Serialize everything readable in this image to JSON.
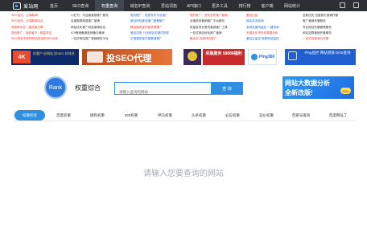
{
  "nav": {
    "logo": "爱站网",
    "items": [
      "首页",
      "SEO查询",
      "权重查询",
      "域名IP查询",
      "爱站词拓",
      "API接口",
      "更多工具",
      "排行榜",
      "客户端",
      "网站统计"
    ],
    "active": 2,
    "icons": [
      "user-icon",
      "login-icon"
    ]
  },
  "links": {
    "columns": [
      [
        "SEO优化，云端新闻！",
        "SEO优化，云端新闻社区",
        "收录率优化，高质量文章",
        "契约推广，新老客户，超高排名",
        "SEO排名专家的网站排名和SEO优化"
      ],
      [
        "小红书，代运营营销推广服务",
        "百度霸屏精准推广营销",
        "网站优化推广网站营销优化",
        "ICP备案备案贴转备办备案",
        "一站式网站推广营销服务平台"
      ],
      [
        "契约推广，信息发布平台推广",
        "新站体验爱站推广套餐推广",
        "精品高质量外链资源推广",
        "爱站词拓 行业网站关键词挖掘",
        "正规高质量外链渠道推广"
      ],
      [
        "契约推广，资讯发布推广营销",
        "百度收录营销推广平台服务",
        "批量查询长尾词营销推广工具",
        "一站式网站优化推广营销",
        "聚合页 百度排名推广"
      ],
      [
        "爱站出品",
        "域名年末促销",
        "全网关键词监控  一键查询",
        "天猫京东拼多多数据分析",
        "爱站云监控 免费网站监控"
      ],
      [
        "全新优化 百度竞价营销托管",
        "推广营销托管服务",
        "专业网站托管管理服务",
        "网站站群营销托管服务",
        "一站式百度竞价托管"
      ]
    ],
    "colors": [
      "#e03b2e",
      "#333333",
      "#2366c7",
      "#e03b2e",
      "#2366c7",
      "#333333"
    ]
  },
  "banners": {
    "b1": "好客户 好网站 好SEO 好排名",
    "b2": "投SEO代理",
    "b3": "采集服务 58888福利",
    "b4": "Ping360",
    "b5": "Ping监控 网站测速 DNS查询"
  },
  "header": {
    "logo_text": "Rank",
    "title": "权重综合",
    "search_placeholder": "请输入查询的网站",
    "search_button": "查 询"
  },
  "ad_right": {
    "line1": "网站大数据分析",
    "line2": "全新改版!",
    "go": "GO>"
  },
  "tabs": [
    "权重综合",
    "百度权重",
    "搜狗权重",
    "360权重",
    "神马权重",
    "头条权重",
    "必应权重",
    "竞价权重",
    "百家号查询",
    "百度网址丁"
  ],
  "active_tab": 0,
  "empty_message": "请输入您要查询的网站"
}
